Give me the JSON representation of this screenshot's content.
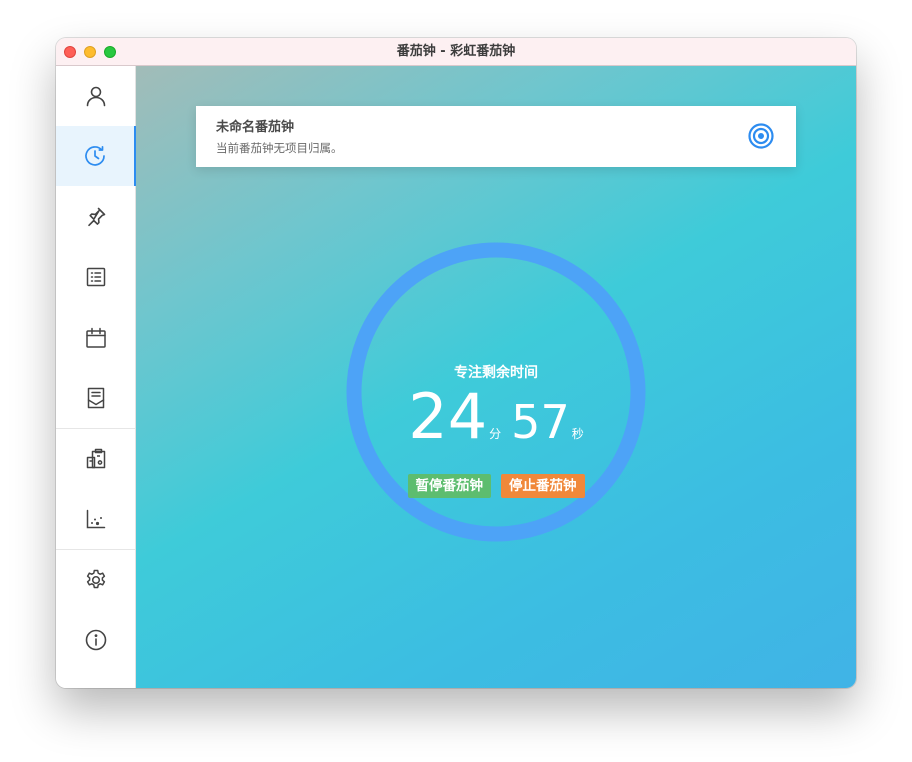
{
  "window": {
    "title": "番茄钟 - 彩虹番茄钟"
  },
  "sidebar": {
    "items": [
      {
        "icon": "user-icon"
      },
      {
        "icon": "clock-icon",
        "active": true
      },
      {
        "icon": "pin-icon"
      },
      {
        "icon": "list-icon"
      },
      {
        "icon": "calendar-icon"
      },
      {
        "icon": "report-icon"
      },
      {
        "icon": "projects-icon"
      },
      {
        "icon": "chart-icon"
      },
      {
        "icon": "gear-icon"
      },
      {
        "icon": "info-icon"
      }
    ],
    "active_color": "#2d8cf0"
  },
  "task": {
    "title": "未命名番茄钟",
    "subtitle": "当前番茄钟无项目归属。",
    "icon": "target-icon"
  },
  "timer": {
    "label": "专注剩余时间",
    "minutes": "24",
    "minutes_unit": "分",
    "seconds": "57",
    "seconds_unit": "秒",
    "ring_color": "#4da3f7"
  },
  "actions": {
    "pause_label": "暂停番茄钟",
    "stop_label": "停止番茄钟",
    "pause_color": "#5dbd6f",
    "stop_color": "#f0883a"
  }
}
